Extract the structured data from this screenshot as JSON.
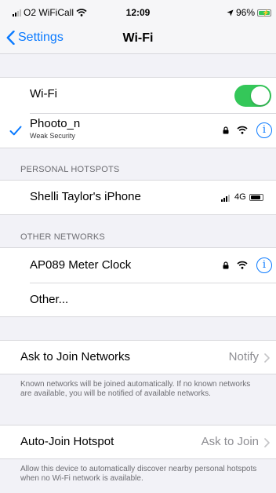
{
  "status": {
    "carrier": "O2 WiFiCall",
    "time": "12:09",
    "battery": "96%"
  },
  "nav": {
    "back_label": "Settings",
    "title": "Wi-Fi"
  },
  "wifi": {
    "label": "Wi-Fi",
    "enabled": true
  },
  "connected": {
    "name": "Phooto_n",
    "subtitle": "Weak Security"
  },
  "personal_hotspots": {
    "header": "PERSONAL HOTSPOTS",
    "items": [
      {
        "name": "Shelli Taylor's iPhone",
        "network": "4G"
      }
    ]
  },
  "other_networks": {
    "header": "OTHER NETWORKS",
    "items": [
      {
        "name": "AP089 Meter Clock"
      },
      {
        "name": "Other..."
      }
    ]
  },
  "ask_to_join": {
    "label": "Ask to Join Networks",
    "value": "Notify",
    "footer": "Known networks will be joined automatically. If no known networks are available, you will be notified of available networks."
  },
  "auto_join": {
    "label": "Auto-Join Hotspot",
    "value": "Ask to Join",
    "footer": "Allow this device to automatically discover nearby personal hotspots when no Wi-Fi network is available."
  },
  "colors": {
    "accent": "#0a7aff",
    "toggle_on": "#34c759",
    "background": "#f2f2f7"
  }
}
